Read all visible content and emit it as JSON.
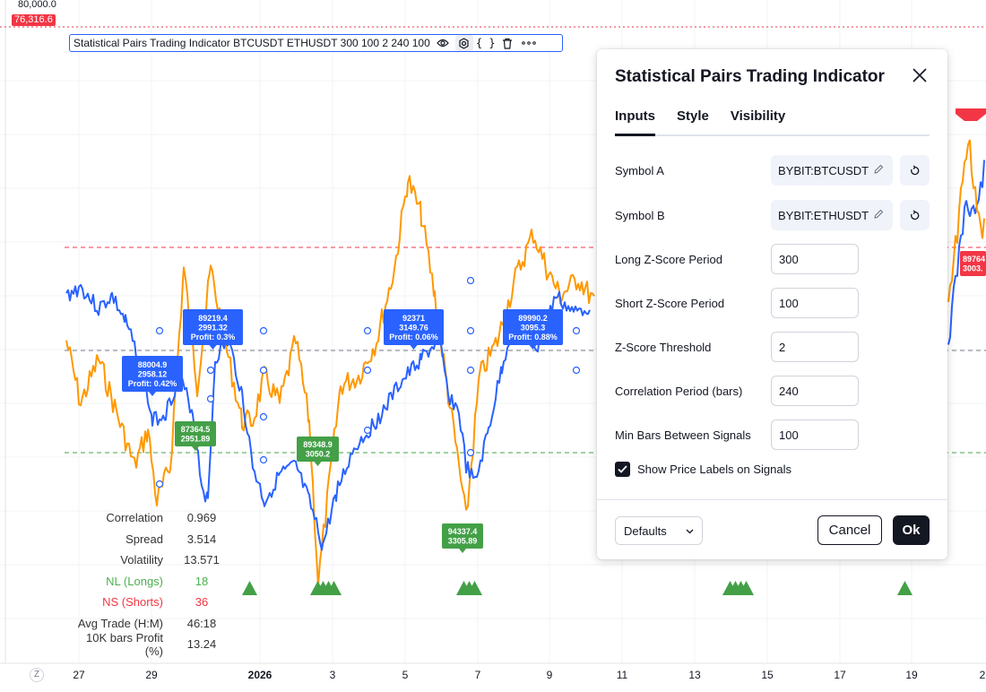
{
  "price_axis": {
    "top_label": "80,000.0",
    "current_price": "76,316.6",
    "current_price_color": "#f23645"
  },
  "legend": {
    "text": "Statistical Pairs Trading Indicator BTCUSDT ETHUSDT 300 100 2 240 100",
    "icons": [
      "eye-icon",
      "settings-icon",
      "source-code-icon",
      "trash-icon",
      "more-icon"
    ]
  },
  "signal_labels": [
    {
      "price_a": "88004.9",
      "price_b": "2958.12",
      "profit": "Profit: 0.42%",
      "color": "#2962ff"
    },
    {
      "price_a": "89219.4",
      "price_b": "2991.32",
      "profit": "Profit: 0.3%",
      "color": "#2962ff"
    },
    {
      "price_a": "92371",
      "price_b": "3149.76",
      "profit": "Profit: 0.06%",
      "color": "#2962ff"
    },
    {
      "price_a": "89990.2",
      "price_b": "3095.3",
      "profit": "Profit: 0.88%",
      "color": "#2962ff"
    },
    {
      "price_a": "87364.5",
      "price_b": "2951.89",
      "profit": "",
      "color": "#43a047"
    },
    {
      "price_a": "89348.9",
      "price_b": "3050.2",
      "profit": "",
      "color": "#43a047"
    },
    {
      "price_a": "94337.4",
      "price_b": "3305.89",
      "profit": "",
      "color": "#43a047"
    },
    {
      "price_a": "89764",
      "price_b": "3003.",
      "profit": "",
      "color": "#f23645"
    }
  ],
  "stats": [
    {
      "label": "Correlation",
      "value": "0.969",
      "tone": "normal"
    },
    {
      "label": "Spread",
      "value": "3.514",
      "tone": "normal"
    },
    {
      "label": "Volatility",
      "value": "13.571",
      "tone": "normal"
    },
    {
      "label": "NL (Longs)",
      "value": "18",
      "tone": "green"
    },
    {
      "label": "NS (Shorts)",
      "value": "36",
      "tone": "red"
    },
    {
      "label": "Avg Trade (H:M)",
      "value": "46:18",
      "tone": "normal"
    },
    {
      "label": "10K bars Profit (%)",
      "value": "13.24",
      "tone": "normal"
    }
  ],
  "x_axis": {
    "corner": "Z",
    "ticks": [
      "27",
      "29",
      "2026",
      "3",
      "5",
      "7",
      "9",
      "11",
      "13",
      "15",
      "17",
      "19",
      "2"
    ]
  },
  "dialog": {
    "title": "Statistical Pairs Trading Indicator",
    "tabs": [
      "Inputs",
      "Style",
      "Visibility"
    ],
    "active_tab": "Inputs",
    "symbol_a_label": "Symbol A",
    "symbol_a_value": "BYBIT:BTCUSDT",
    "symbol_b_label": "Symbol B",
    "symbol_b_value": "BYBIT:ETHUSDT",
    "fields": [
      {
        "label": "Long Z-Score Period",
        "value": "300"
      },
      {
        "label": "Short Z-Score Period",
        "value": "100"
      },
      {
        "label": "Z-Score Threshold",
        "value": "2"
      },
      {
        "label": "Correlation Period (bars)",
        "value": "240"
      },
      {
        "label": "Min Bars Between Signals",
        "value": "100"
      }
    ],
    "checkbox_label": "Show Price Labels on Signals",
    "checkbox_checked": true,
    "defaults_label": "Defaults",
    "cancel_label": "Cancel",
    "ok_label": "Ok"
  },
  "colors": {
    "series_a": "#2962ff",
    "series_b": "#ff9800",
    "upper_band": "#f23645",
    "lower_band": "#43a047",
    "mid_band": "#787b86"
  }
}
